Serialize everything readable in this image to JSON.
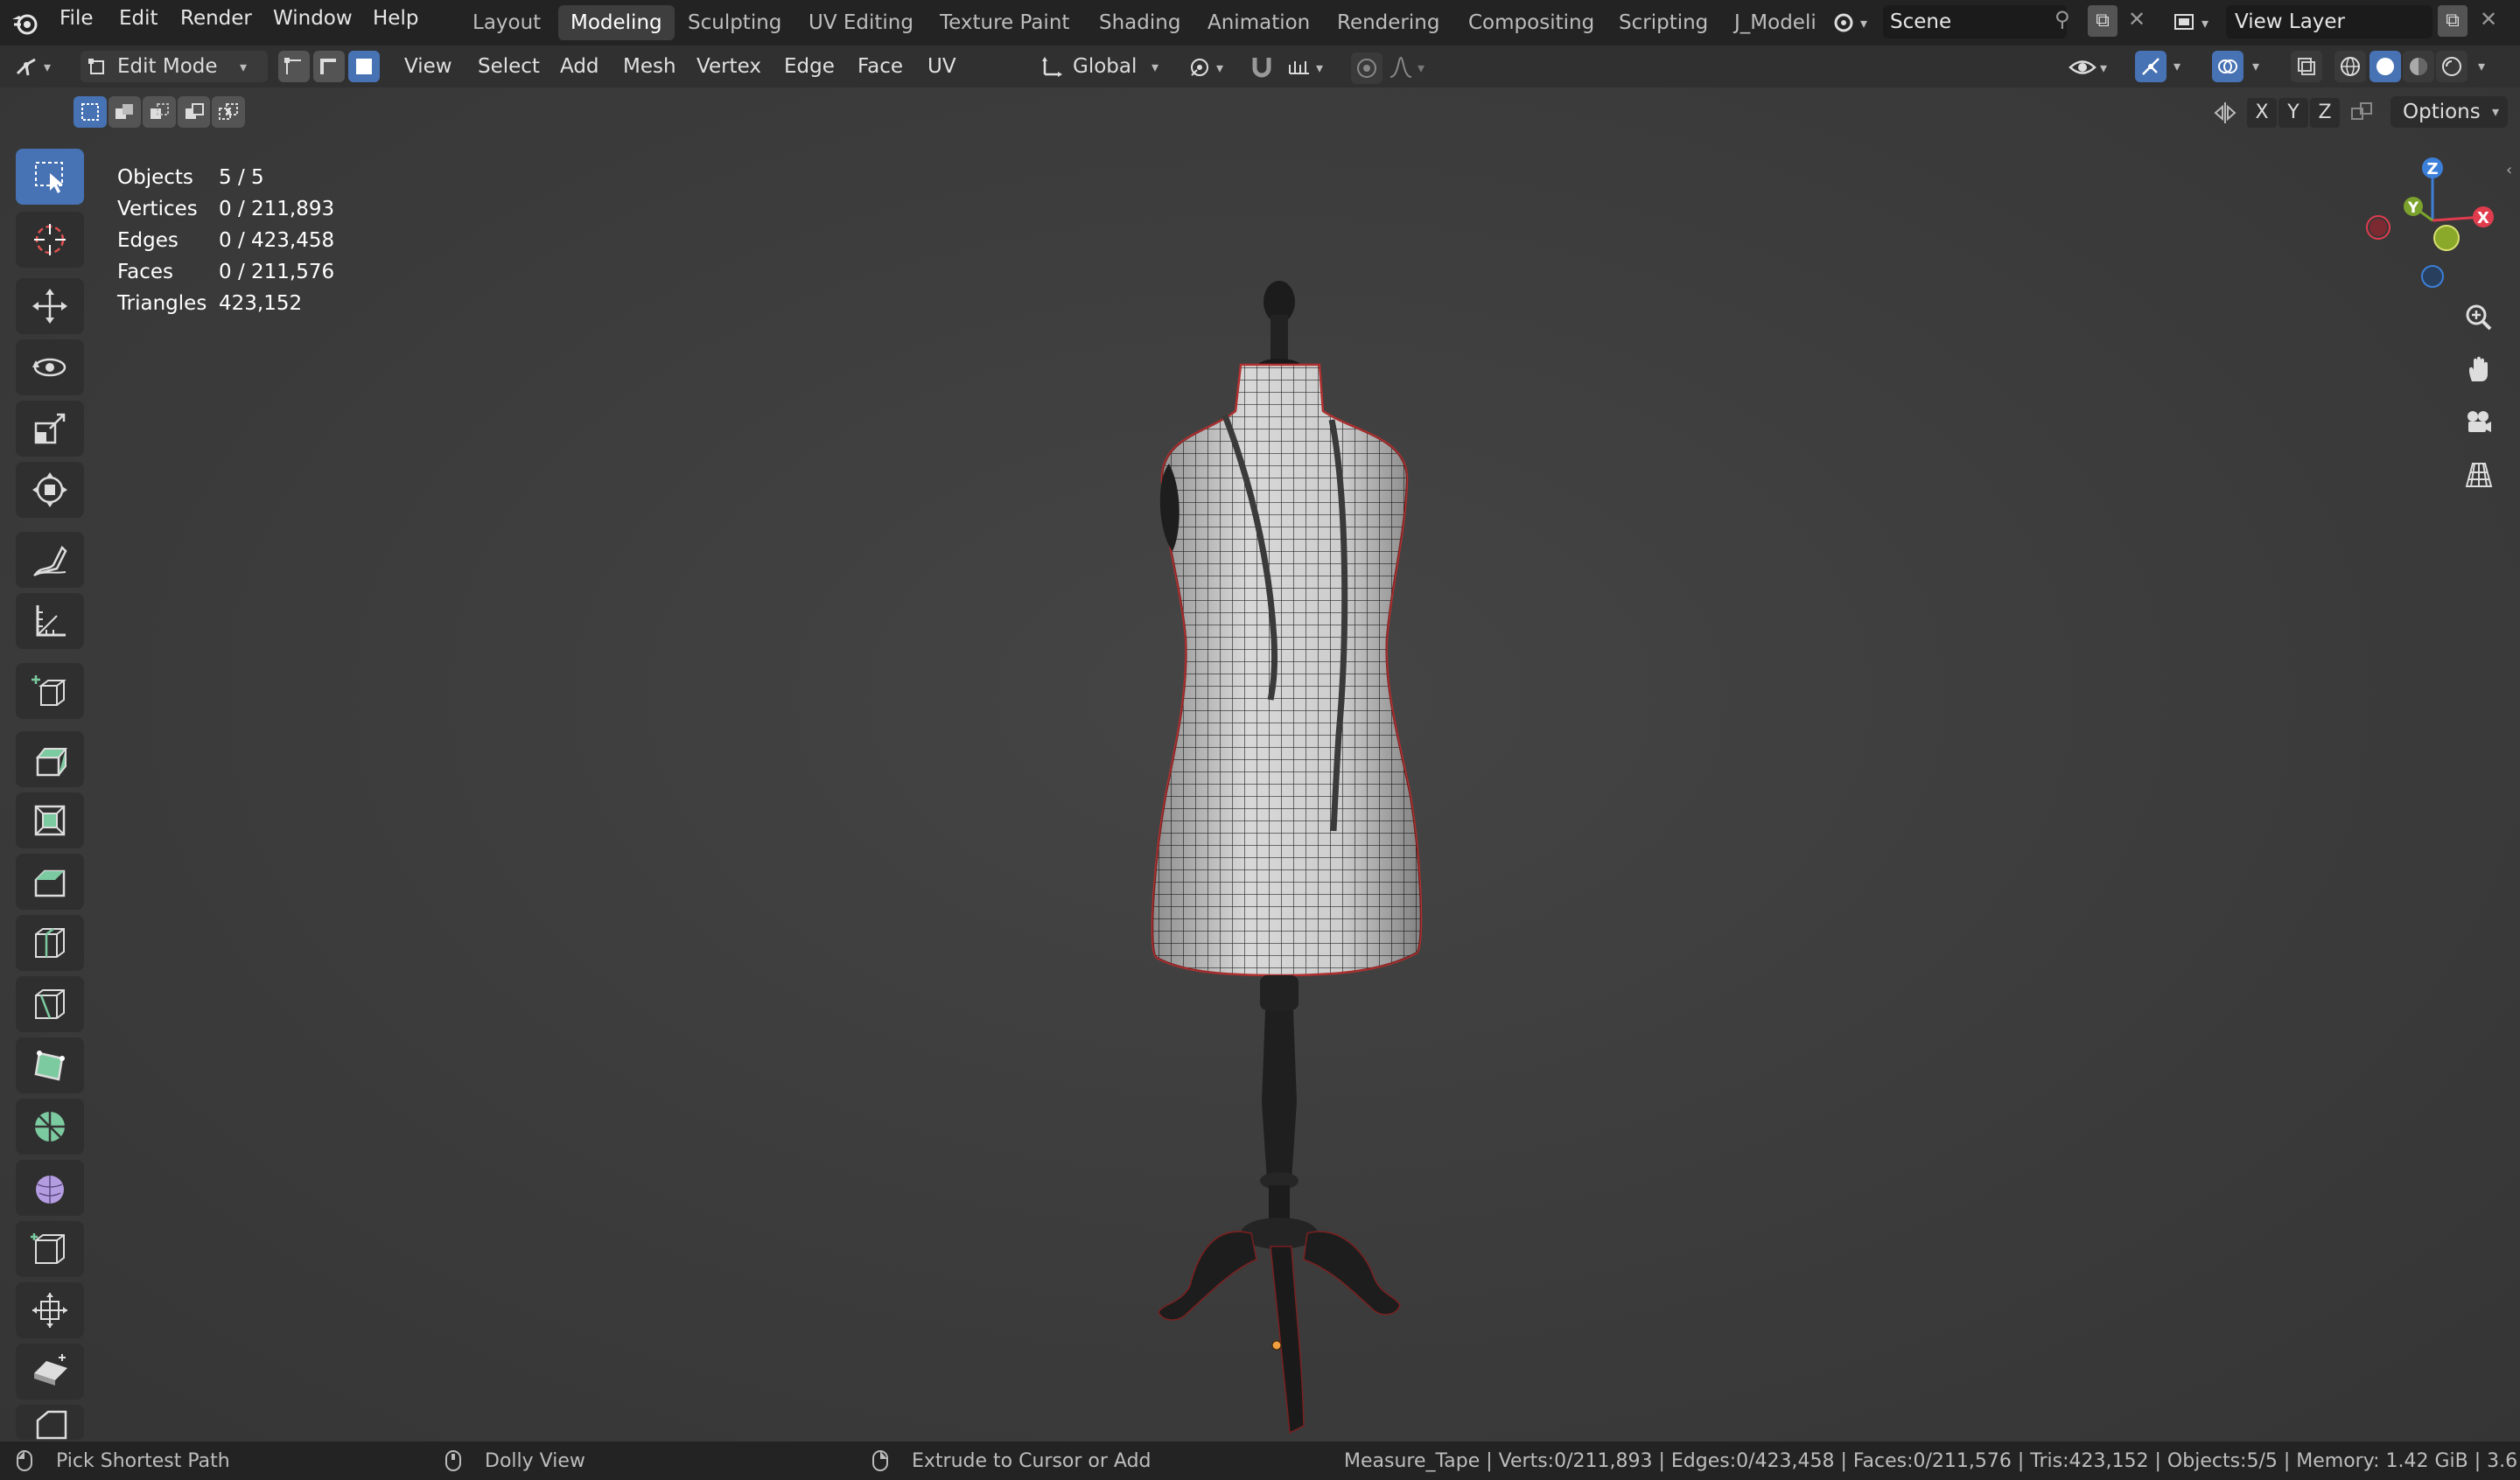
{
  "top_menu": {
    "items": [
      "File",
      "Edit",
      "Render",
      "Window",
      "Help"
    ]
  },
  "workspaces": {
    "tabs": [
      "Layout",
      "Modeling",
      "Sculpting",
      "UV Editing",
      "Texture Paint",
      "Shading",
      "Animation",
      "Rendering",
      "Compositing",
      "Scripting",
      "J_Modeli"
    ],
    "active": "Modeling"
  },
  "scene": {
    "name": "Scene"
  },
  "view_layer": {
    "name": "View Layer"
  },
  "header": {
    "mode": "Edit Mode",
    "menus": [
      "View",
      "Select",
      "Add",
      "Mesh",
      "Vertex",
      "Edge",
      "Face",
      "UV"
    ],
    "transform_orientation": "Global",
    "options_label": "Options",
    "axis_labels": [
      "X",
      "Y",
      "Z"
    ]
  },
  "stats": [
    {
      "label": "Objects",
      "value": "5 / 5"
    },
    {
      "label": "Vertices",
      "value": "0 / 211,893"
    },
    {
      "label": "Edges",
      "value": "0 / 423,458"
    },
    {
      "label": "Faces",
      "value": "0 / 211,576"
    },
    {
      "label": "Triangles",
      "value": "423,152"
    }
  ],
  "gizmo": {
    "x": "X",
    "y": "Y",
    "z": "Z"
  },
  "status_bar": {
    "left_hint": "Pick Shortest Path",
    "middle_hint": "Dolly View",
    "right_hint": "Extrude to Cursor or Add",
    "info": "Measure_Tape | Verts:0/211,893 | Edges:0/423,458 | Faces:0/211,576 | Tris:423,152 | Objects:5/5 | Memory: 1.42 GiB | 3.6"
  },
  "colors": {
    "accent": "#4772b3",
    "axis_x": "#e03c4e",
    "axis_y": "#7aa22c",
    "axis_z": "#3c7fd8",
    "tool_add": "#7ccaa0"
  }
}
